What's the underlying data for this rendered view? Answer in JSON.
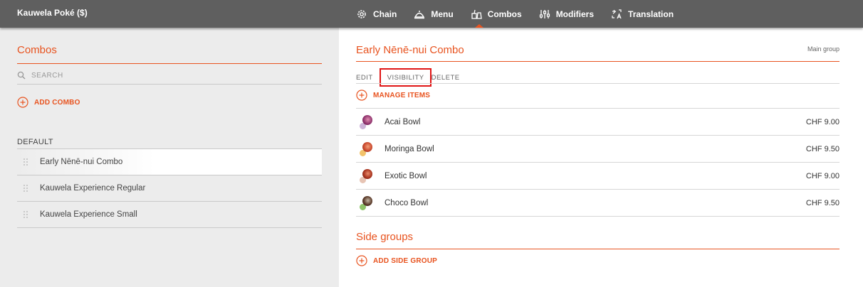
{
  "header": {
    "brand": "Kauwela Poké ($)",
    "nav": [
      {
        "label": "Chain",
        "icon": "gear-icon"
      },
      {
        "label": "Menu",
        "icon": "cloche-icon"
      },
      {
        "label": "Combos",
        "icon": "combo-icon",
        "active": true
      },
      {
        "label": "Modifiers",
        "icon": "sliders-icon"
      },
      {
        "label": "Translation",
        "icon": "translate-icon"
      }
    ]
  },
  "sidebar": {
    "title": "Combos",
    "search_placeholder": "SEARCH",
    "add_label": "ADD COMBO",
    "group_label": "DEFAULT",
    "items": [
      {
        "label": "Early Nēnē-nui Combo",
        "selected": true
      },
      {
        "label": "Kauwela Experience Regular"
      },
      {
        "label": "Kauwela Experience Small"
      }
    ]
  },
  "main": {
    "title": "Early Nēnē-nui Combo",
    "badge": "Main group",
    "tabs": {
      "edit": "EDIT",
      "visibility": "VISIBILITY",
      "delete": "DELETE"
    },
    "manage_label": "MANAGE ITEMS",
    "items": [
      {
        "name": "Acai Bowl",
        "price": "CHF 9.00"
      },
      {
        "name": "Moringa Bowl",
        "price": "CHF 9.50"
      },
      {
        "name": "Exotic Bowl",
        "price": "CHF 9.00"
      },
      {
        "name": "Choco Bowl",
        "price": "CHF 9.50"
      }
    ],
    "side_title": "Side groups",
    "add_side_label": "ADD SIDE GROUP"
  },
  "colors": {
    "accent": "#e8531f",
    "topbar": "#5f5f5f",
    "sidebar_bg": "#ececec",
    "highlight_box": "#e01515"
  }
}
